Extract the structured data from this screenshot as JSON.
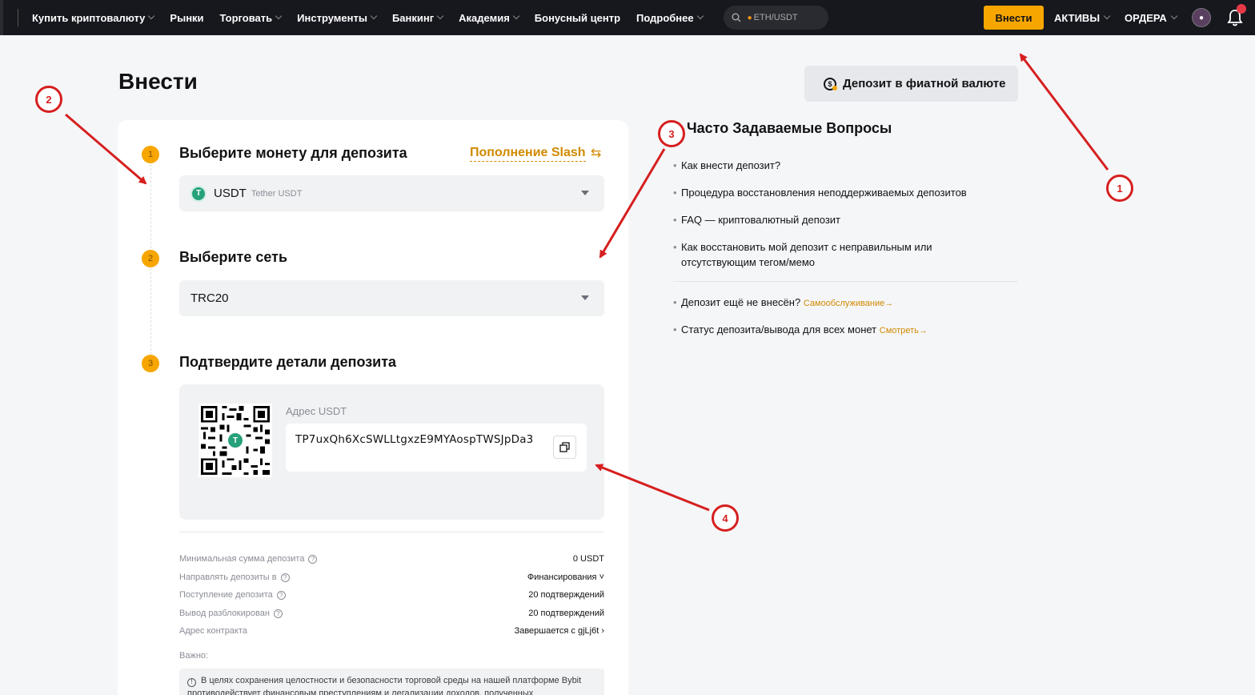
{
  "nav": {
    "items": [
      {
        "label": "Купить криптовалюту",
        "has_menu": true
      },
      {
        "label": "Рынки",
        "has_menu": false
      },
      {
        "label": "Торговать",
        "has_menu": true
      },
      {
        "label": "Инструменты",
        "has_menu": true
      },
      {
        "label": "Банкинг",
        "has_menu": true
      },
      {
        "label": "Академия",
        "has_menu": true
      },
      {
        "label": "Бонусный центр",
        "has_menu": false
      },
      {
        "label": "Подробнее",
        "has_menu": true
      }
    ],
    "search_text": "ETH/USDT",
    "deposit_label": "Внести",
    "assets_label": "АКТИВЫ",
    "orders_label": "ОРДЕРА"
  },
  "page": {
    "title": "Внести",
    "fiat_button": "Депозит в фиатной валюте"
  },
  "steps": {
    "s1": {
      "number": "1",
      "title": "Выберите монету для депозита",
      "slash_link": "Пополнение Slash",
      "coin": "USDT",
      "coin_full": "Tether USDT"
    },
    "s2": {
      "number": "2",
      "title": "Выберите сеть",
      "network": "TRC20"
    },
    "s3": {
      "number": "3",
      "title": "Подтвердите детали депозита",
      "address_label": "Адрес USDT",
      "address": "TP7uxQh6XcSWLLtgxzE9MYAospTWSJpDa3"
    }
  },
  "details": [
    {
      "label": "Минимальная сумма депозита",
      "help": true,
      "value": "0 USDT"
    },
    {
      "label": "Направлять депозиты в",
      "help": true,
      "value": "Финансирования ˅"
    },
    {
      "label": "Поступление депозита",
      "help": true,
      "value": "20 подтверждений"
    },
    {
      "label": "Вывод разблокирован",
      "help": true,
      "value": "20 подтверждений"
    },
    {
      "label": "Адрес контракта",
      "help": false,
      "value": "Завершается с gjLj6t ›"
    }
  ],
  "important": {
    "label": "Важно:",
    "text": "В целях сохранения целостности и безопасности торговой среды на нашей платформе Bybit противодействует финансовым преступлениям и легализации доходов, полученных"
  },
  "faq": {
    "title": "Часто Задаваемые Вопросы",
    "items": [
      "Как внести депозит?",
      "Процедура восстановления неподдерживаемых депозитов",
      "FAQ — криптовалютный депозит",
      "Как восстановить мой депозит с неправильным или отсутствующим тегом/мемо"
    ],
    "extra": [
      {
        "text": "Депозит ещё не внесён?",
        "link": "Самообслуживание"
      },
      {
        "text": "Статус депозита/вывода для всех монет",
        "link": "Смотреть"
      }
    ]
  },
  "annotations": [
    "1",
    "2",
    "3",
    "4"
  ],
  "colors": {
    "accent": "#f7a600",
    "link": "#d18a00",
    "annotation": "#d61f1f",
    "usdt": "#26a17b"
  }
}
